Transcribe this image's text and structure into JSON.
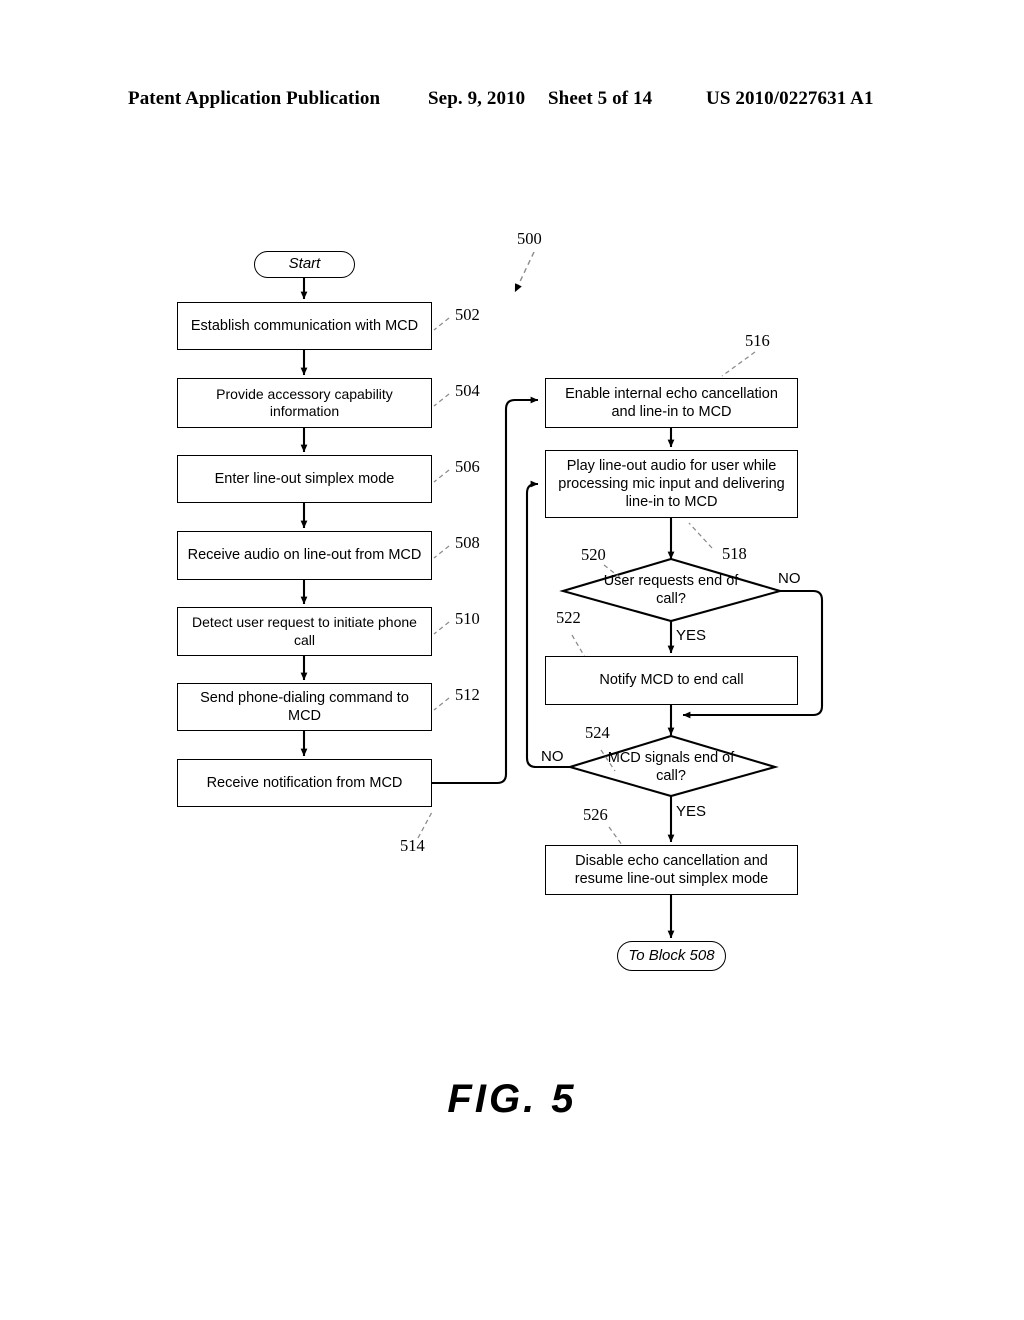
{
  "header": {
    "publication": "Patent Application Publication",
    "date": "Sep. 9, 2010",
    "sheet": "Sheet 5 of 14",
    "patent_number": "US 2010/0227631 A1"
  },
  "figure": {
    "caption": "FIG. 5",
    "diagram_ref": "500"
  },
  "flowchart": {
    "type": "flowchart",
    "start": {
      "label": "Start"
    },
    "end": {
      "label": "To Block 508"
    },
    "left_column": [
      {
        "ref": "502",
        "text": "Establish communication with MCD"
      },
      {
        "ref": "504",
        "text": "Provide accessory capability information"
      },
      {
        "ref": "506",
        "text": "Enter line-out simplex mode"
      },
      {
        "ref": "508",
        "text": "Receive audio on line-out from MCD"
      },
      {
        "ref": "510",
        "text": "Detect user request to initiate phone call"
      },
      {
        "ref": "512",
        "text": "Send phone-dialing command to MCD"
      },
      {
        "ref": "514",
        "text": "Receive notification from MCD"
      }
    ],
    "right_column": [
      {
        "ref": "516",
        "text": "Enable internal echo cancellation and line-in to MCD"
      },
      {
        "ref": "518",
        "text": "Play line-out audio for user while processing mic input and delivering line-in to MCD"
      },
      {
        "ref": "520",
        "text": "User requests end of call?",
        "shape": "decision"
      },
      {
        "ref": "522",
        "text": "Notify MCD to end call"
      },
      {
        "ref": "524",
        "text": "MCD signals end of call?",
        "shape": "decision"
      },
      {
        "ref": "526",
        "text": "Disable echo cancellation and resume line-out simplex mode"
      }
    ],
    "branch_labels": {
      "d520_no": "NO",
      "d520_yes": "YES",
      "d524_no": "NO",
      "d524_yes": "YES"
    }
  }
}
